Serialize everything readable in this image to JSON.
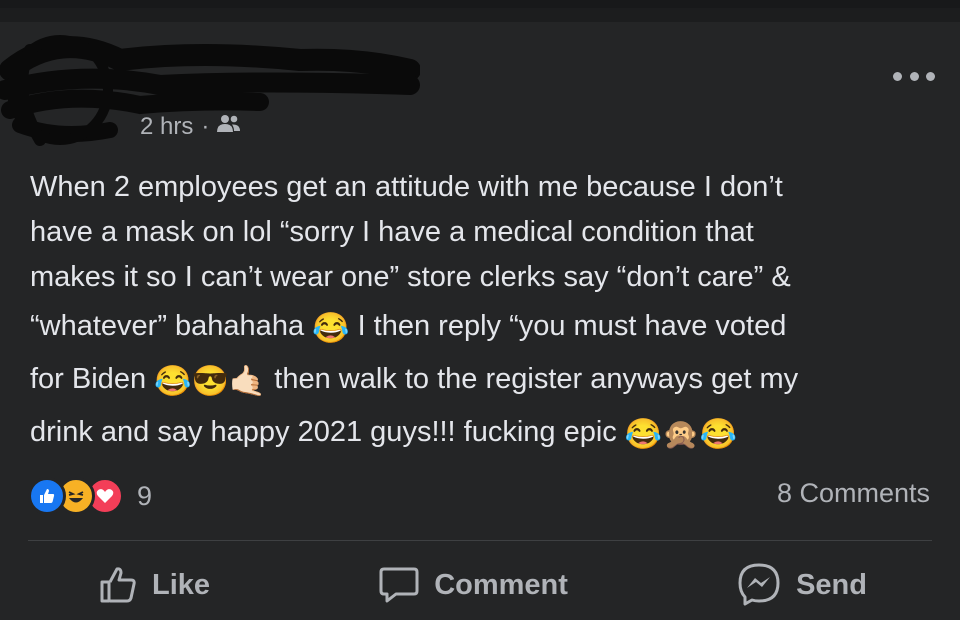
{
  "post": {
    "timestamp": "2 hrs",
    "separator": "·",
    "audience_icon": "friends-icon",
    "more_icon": "ellipsis-icon",
    "text_lines": [
      "When 2 employees get an attitude with me because I don’t",
      "have a mask on lol “sorry I have a medical condition that",
      "makes it so I can’t wear one” store clerks say “don’t care” &",
      "“whatever” bahahaha",
      "I then reply “you must have voted",
      "for Biden",
      "then walk to the register anyways get my",
      "drink and say happy 2021 guys!!! fucking epic"
    ],
    "emoji": {
      "laugh": "😂",
      "cool": "😎",
      "call_me": "🤙🏻",
      "monkey": "🙊"
    }
  },
  "reactions": {
    "types": [
      "like",
      "haha",
      "love"
    ],
    "count": "9",
    "comments": "8 Comments"
  },
  "actions": {
    "like": "Like",
    "comment": "Comment",
    "send": "Send"
  },
  "colors": {
    "background": "#242526",
    "text": "#e4e6eb",
    "secondary": "#b0b3b8",
    "like_blue": "#1877f2",
    "love_red": "#f33e58",
    "haha_yellow": "#f7b125"
  }
}
